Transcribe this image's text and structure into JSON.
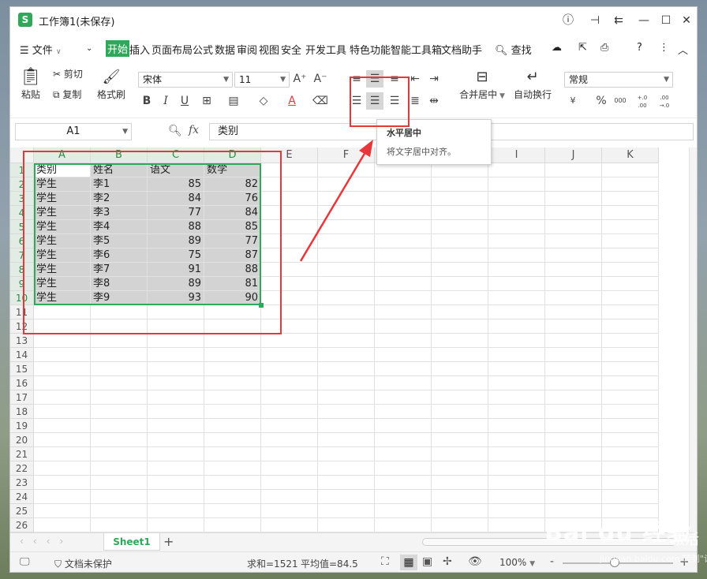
{
  "window": {
    "title": "工作簿1(未保存)"
  },
  "titlebar_icons": [
    "info-icon",
    "pin-icon",
    "minimize-to-tray-icon",
    "minimize-icon",
    "maximize-icon",
    "close-icon"
  ],
  "menu": {
    "file_label": "文件",
    "items": [
      "开始",
      "插入",
      "页面布局",
      "公式",
      "数据",
      "审阅",
      "视图",
      "安全",
      "开发工具",
      "特色功能",
      "智能工具箱",
      "文档助手"
    ],
    "active": "开始",
    "search_label": "查找"
  },
  "ribbon": {
    "paste_label": "粘贴",
    "cut_label": "剪切",
    "copy_label": "复制",
    "format_painter_label": "格式刷",
    "font_name": "宋体",
    "font_size": "11",
    "merge_label": "合并居中",
    "wrap_label": "自动换行",
    "number_format": "常规",
    "currency_symbol": "¥",
    "percent_symbol": "%",
    "thousands_label": "000",
    "dec_inc_label": "+.0 .00",
    "dec_dec_label": ".00 →.0",
    "bold": "B",
    "italic": "I",
    "underline": "U",
    "font_color_label": "A",
    "font_color": "#e8373b"
  },
  "formula_bar": {
    "cell_ref": "A1",
    "fx_label": "fx",
    "content": "类别"
  },
  "tooltip": {
    "title": "水平居中",
    "description": "将文字居中对齐。"
  },
  "columns": [
    "A",
    "B",
    "C",
    "D",
    "E",
    "F",
    "G",
    "H",
    "I",
    "J",
    "K"
  ],
  "rows": [
    "1",
    "2",
    "3",
    "4",
    "5",
    "6",
    "7",
    "8",
    "9",
    "10",
    "11",
    "12",
    "13",
    "14",
    "15",
    "16",
    "17",
    "18",
    "19",
    "20",
    "21",
    "22",
    "23",
    "24",
    "25",
    "26"
  ],
  "table": {
    "header": [
      "类别",
      "姓名",
      "语文",
      "数学"
    ],
    "rows": [
      [
        "学生",
        "李1",
        "85",
        "82"
      ],
      [
        "学生",
        "李2",
        "84",
        "76"
      ],
      [
        "学生",
        "李3",
        "77",
        "84"
      ],
      [
        "学生",
        "李4",
        "88",
        "85"
      ],
      [
        "学生",
        "李5",
        "89",
        "77"
      ],
      [
        "学生",
        "李6",
        "75",
        "87"
      ],
      [
        "学生",
        "李7",
        "91",
        "88"
      ],
      [
        "学生",
        "李8",
        "89",
        "81"
      ],
      [
        "学生",
        "李9",
        "93",
        "90"
      ]
    ]
  },
  "sheets": {
    "tabs": [
      "Sheet1"
    ],
    "add_label": "+"
  },
  "status": {
    "protect_label": "文档未保护",
    "sum_label": "求和=1521",
    "avg_label": "平均值=84.5",
    "zoom": "100%",
    "zoom_minus": "-",
    "zoom_plus": "+"
  },
  "watermark": {
    "text": "Bai du 经验",
    "sub": "激活",
    "sub2": "jingyan.baidu.com 转到\"设"
  },
  "colors": {
    "accent": "#2fa85a",
    "annotation": "#e8373b",
    "selection": "#d3d3d3"
  }
}
